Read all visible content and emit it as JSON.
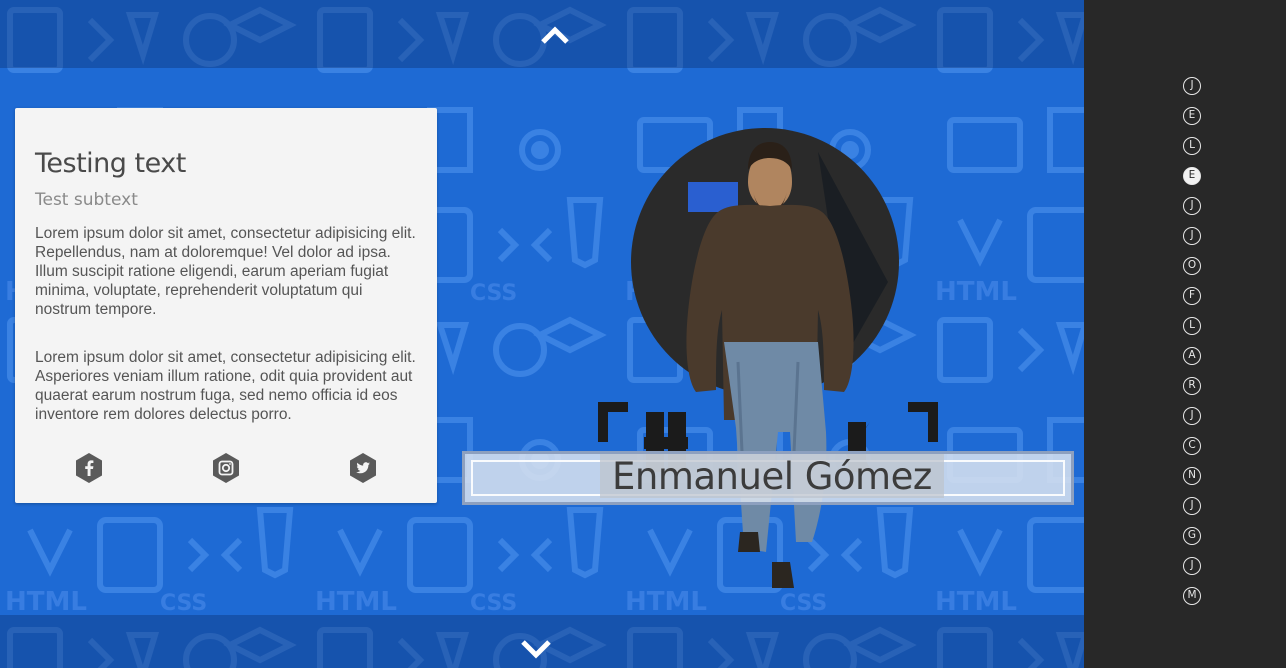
{
  "colors": {
    "stage_bg": "#1e6ad4",
    "sidebar_bg": "#282828",
    "card_bg": "#f4f4f4"
  },
  "nav": {
    "up_icon": "chevron-up-icon",
    "down_icon": "chevron-down-icon"
  },
  "card": {
    "title": "Testing text",
    "subtitle": "Test subtext",
    "paragraphs": [
      "Lorem ipsum dolor sit amet, consectetur adipisicing elit. Repellendus, nam at doloremque! Vel dolor ad ipsa. Illum suscipit ratione eligendi, earum aperiam fugiat minima, voluptate, reprehenderit voluptatum qui nostrum tempore.",
      "Lorem ipsum dolor sit amet, consectetur adipisicing elit. Asperiores veniam illum ratione, odit quia provident aut quaerat earum nostrum fuga, sed nemo officia id eos inventore rem dolores delectus porro."
    ],
    "social": [
      "facebook-icon",
      "instagram-icon",
      "twitter-icon"
    ]
  },
  "hero": {
    "name": "Enmanuel Gómez"
  },
  "sidebar": {
    "items": [
      "J",
      "E",
      "L",
      "E",
      "J",
      "J",
      "O",
      "F",
      "L",
      "A",
      "R",
      "J",
      "C",
      "N",
      "J",
      "G",
      "J",
      "M"
    ],
    "active_index": 3
  }
}
